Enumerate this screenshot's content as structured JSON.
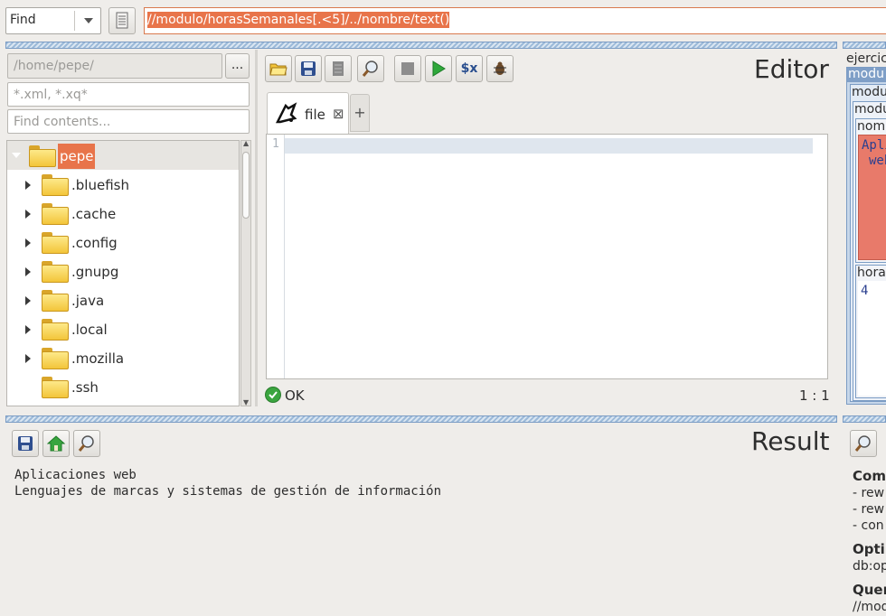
{
  "topbar": {
    "mode": "Find",
    "query": "//modulo/horasSemanales[.<5]/../nombre/text()"
  },
  "project": {
    "path_placeholder": "/home/pepe/",
    "browse_label": "...",
    "filter_placeholder": "*.xml, *.xq*",
    "contents_placeholder": "Find contents...",
    "tree": [
      {
        "label": "pepe",
        "expanded": true,
        "selected": true
      },
      {
        "label": ".bluefish"
      },
      {
        "label": ".cache"
      },
      {
        "label": ".config"
      },
      {
        "label": ".gnupg"
      },
      {
        "label": ".java"
      },
      {
        "label": ".local"
      },
      {
        "label": ".mozilla"
      },
      {
        "label": ".ssh"
      }
    ]
  },
  "editor": {
    "title": "Editor",
    "tab_label": "file",
    "line_number": "1",
    "status": "OK",
    "position": "1 : 1"
  },
  "result": {
    "title": "Result",
    "lines": [
      "Aplicaciones web",
      "Lenguajes de marcas y sistemas de gestión de información"
    ]
  },
  "map": {
    "root": "ejercic",
    "node1": "modu",
    "node2": "modu",
    "node3": "modu",
    "nombre": "nomb",
    "value1": "Apli",
    "value2": "web",
    "horas": "horas",
    "horas_value": "4"
  },
  "info": {
    "compile_heading": "Com",
    "compile_items": [
      "- rew",
      "- rew",
      "- con"
    ],
    "optimized_heading": "Optim",
    "optimized_value": "db:op",
    "query_heading": "Quer",
    "query_value": "//mod"
  },
  "colors": {
    "accent": "#e8744a",
    "panel_strip": "#9cbad9",
    "map_fill": "#e87a6a"
  }
}
